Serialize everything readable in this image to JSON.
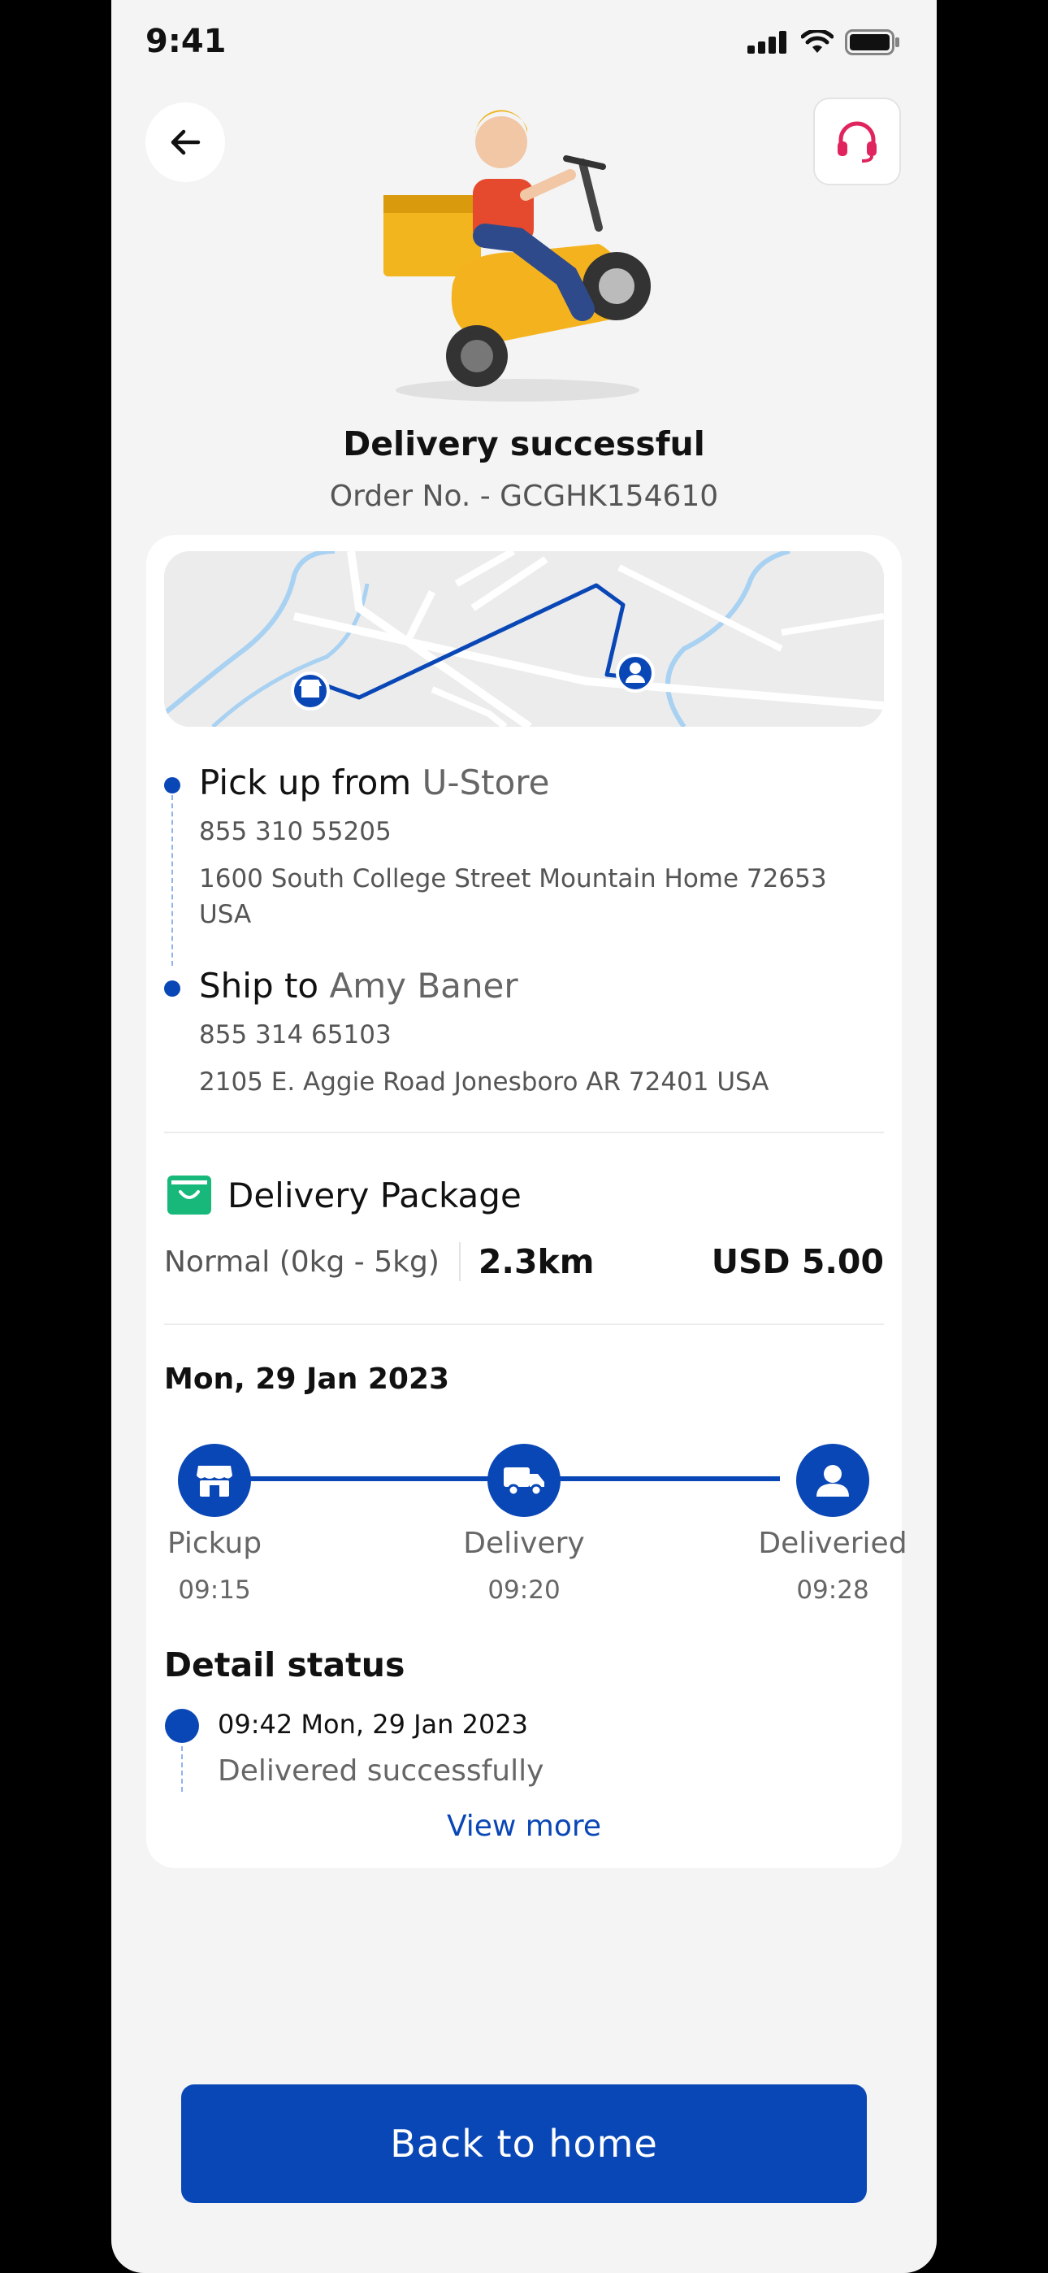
{
  "status_bar": {
    "time": "9:41"
  },
  "header": {
    "title": "Delivery successful",
    "order_no": "Order No. - GCGHK154610"
  },
  "pickup": {
    "label": "Pick up from",
    "name": "U-Store",
    "phone": "855 310 55205",
    "address": "1600 South College Street Mountain Home 72653 USA"
  },
  "ship": {
    "label": "Ship to",
    "name": "Amy Baner",
    "phone": "855 314 65103",
    "address": "2105 E. Aggie Road Jonesboro AR 72401 USA"
  },
  "package": {
    "title": "Delivery Package",
    "type": "Normal (0kg - 5kg)",
    "distance": "2.3km",
    "price": "USD 5.00"
  },
  "timeline": {
    "date": "Mon, 29 Jan 2023",
    "steps": [
      {
        "label": "Pickup",
        "time": "09:15",
        "icon": "store-icon"
      },
      {
        "label": "Delivery",
        "time": "09:20",
        "icon": "truck-icon"
      },
      {
        "label": "Deliveried",
        "time": "09:28",
        "icon": "person-icon"
      }
    ]
  },
  "detail_status": {
    "title": "Detail status",
    "time": "09:42 Mon, 29 Jan 2023",
    "text": "Delivered successfully",
    "view_more": "View more"
  },
  "footer": {
    "button": "Back to home"
  },
  "colors": {
    "primary": "#0a47b6",
    "support": "#e0245e",
    "package_icon": "#17b87a"
  }
}
